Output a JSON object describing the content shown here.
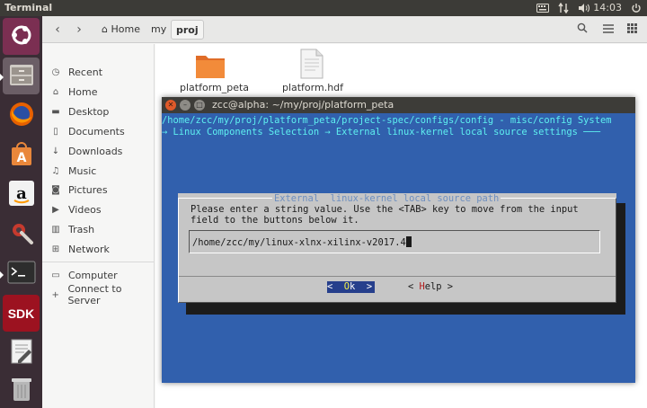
{
  "top_panel": {
    "app_title": "Terminal",
    "clock": "14:03",
    "tray_icons": [
      "keyboard-icon",
      "network-arrows-icon",
      "volume-icon",
      "power-icon"
    ]
  },
  "launcher": {
    "items": [
      {
        "name": "ubuntu-dash",
        "icon": "ubuntu-logo-icon",
        "bg": "#7b2f52"
      },
      {
        "name": "files",
        "icon": "file-cabinet-icon",
        "bg": "#6b5e66"
      },
      {
        "name": "firefox",
        "icon": "firefox-icon",
        "bg": "#4a3b43"
      },
      {
        "name": "software-center",
        "icon": "shopping-bag-icon",
        "bg": "#4a3b43"
      },
      {
        "name": "amazon",
        "icon": "amazon-icon",
        "bg": "#4a3b43"
      },
      {
        "name": "settings",
        "icon": "wrench-gear-icon",
        "bg": "#4a3b43"
      },
      {
        "name": "terminal",
        "icon": "terminal-icon",
        "bg": "#4a3b43"
      },
      {
        "name": "sdk",
        "label": "SDK",
        "icon": "sdk-icon",
        "bg": "#9c1220"
      },
      {
        "name": "text-editor",
        "icon": "text-editor-icon",
        "bg": "#4a3b43"
      },
      {
        "name": "trash",
        "icon": "trash-icon",
        "bg": "#4a3b43"
      }
    ]
  },
  "files": {
    "breadcrumbs": [
      "Home",
      "my",
      "proj"
    ],
    "sidebar": [
      {
        "label": "Recent",
        "icon": "clock-icon"
      },
      {
        "label": "Home",
        "icon": "home-icon"
      },
      {
        "label": "Desktop",
        "icon": "folder-icon"
      },
      {
        "label": "Documents",
        "icon": "document-icon"
      },
      {
        "label": "Downloads",
        "icon": "download-icon"
      },
      {
        "label": "Music",
        "icon": "music-icon"
      },
      {
        "label": "Pictures",
        "icon": "camera-icon"
      },
      {
        "label": "Videos",
        "icon": "video-icon"
      },
      {
        "label": "Trash",
        "icon": "trash-icon"
      },
      {
        "label": "Network",
        "icon": "network-icon"
      },
      {
        "label": "Computer",
        "icon": "computer-icon"
      },
      {
        "label": "Connect to Server",
        "icon": "server-icon"
      }
    ],
    "items": [
      {
        "label": "platform_peta",
        "icon": "folder-icon"
      },
      {
        "label": "platform.hdf",
        "icon": "document-icon"
      }
    ]
  },
  "terminal": {
    "title": "zcc@alpha: ~/my/proj/platform_peta",
    "line1": "/home/zcc/my/proj/platform_peta/project-spec/configs/config - misc/config System",
    "line2": "→ Linux Components Selection → External linux-kernel local source settings ───",
    "dialog": {
      "title": "External  linux-kernel local source path",
      "text_line1": "Please enter a string value. Use the <TAB> key to move from the input",
      "text_line2": "field to the buttons below it.",
      "input_value": "/home/zcc/my/linux-xlnx-xilinx-v2017.4",
      "ok_open": "<  ",
      "ok_hotkey": "O",
      "ok_rest": "k  >",
      "help_open": "< ",
      "help_hotkey": "H",
      "help_rest": "elp >"
    }
  },
  "colors": {
    "terminal_bg": "#3160ad",
    "terminal_text": "#5ef0f0",
    "dialog_bg": "#c6c6c6",
    "launcher_bg": "#3a2d35",
    "ok_button": "#263f8c"
  }
}
